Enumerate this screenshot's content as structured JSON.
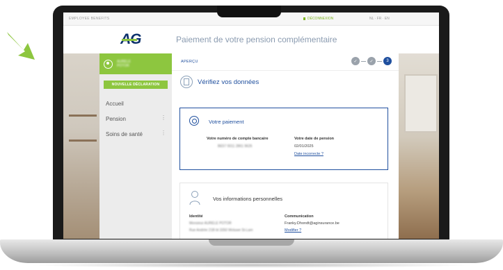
{
  "colors": {
    "accent_green": "#8dc63f",
    "primary_blue": "#1f4f9e",
    "logo_navy": "#0a2f6b"
  },
  "topbar": {
    "brand": "EMPLOYEE BENEFITS",
    "logout_label": "DÉCONNEXION",
    "languages": "NL · FR · EN"
  },
  "header": {
    "logo_text": "AG",
    "page_title": "Paiement de votre pension complémentaire"
  },
  "sidebar": {
    "user_name_line1": "AURELE",
    "user_name_line2": "POTOR",
    "new_declaration_label": "NOUVELLE DÉCLARATION",
    "items": [
      {
        "label": "Accueil"
      },
      {
        "label": "Pension"
      },
      {
        "label": "Soins de santé"
      }
    ]
  },
  "main": {
    "section_label": "APERÇU",
    "steps": [
      {
        "mark": "✓"
      },
      {
        "mark": "✓"
      },
      {
        "mark": "3"
      }
    ],
    "verify_title": "Vérifiez vos données",
    "payment": {
      "title": "Votre paiement",
      "bank_label": "Votre numéro de compte bancaire",
      "bank_value": "BE57 0011 2861 9626",
      "date_label": "Votre date de pension",
      "date_value": "02/01/2025",
      "date_link": "Date incorrecte ?"
    },
    "personal": {
      "title": "Vos informations personnelles",
      "identity_label": "Identité",
      "identity_line1": "Monsieur AURELE POTOR",
      "identity_line2": "Rue Andrée 21B bt 3350 Woluwe St-Lam",
      "communication_label": "Communication",
      "email": "Franky.Dhondt@aginsurance.be",
      "modify_link": "Modifier ?"
    }
  }
}
